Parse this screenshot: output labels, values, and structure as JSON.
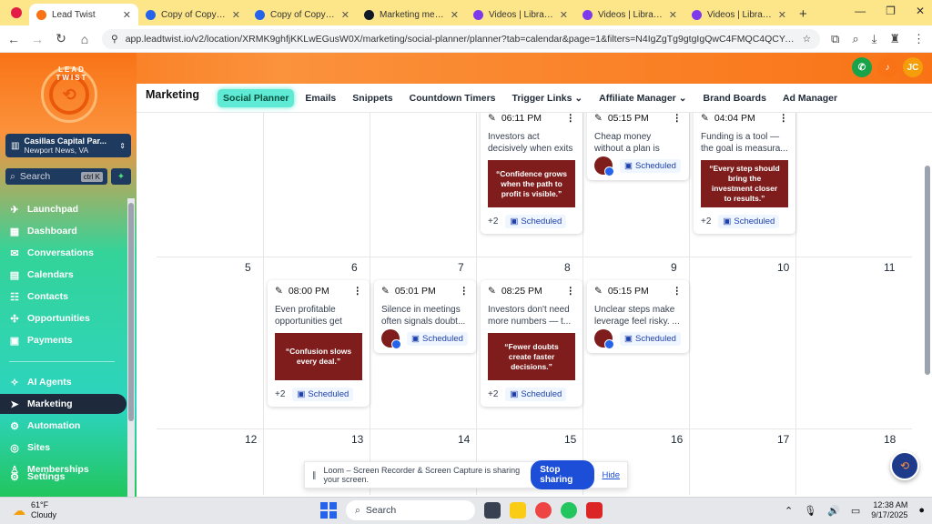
{
  "browser": {
    "tabs": [
      {
        "title": "Lead Twist",
        "active": true,
        "favicon_color": "#f97316"
      },
      {
        "title": "Copy of Copy of Co",
        "active": false,
        "favicon_color": "#2563eb"
      },
      {
        "title": "Copy of Copy of Co",
        "active": false,
        "favicon_color": "#2563eb"
      },
      {
        "title": "Marketing message",
        "active": false,
        "favicon_color": "#111827"
      },
      {
        "title": "Videos | Library |",
        "active": false,
        "favicon_color": "#7c3aed"
      },
      {
        "title": "Videos | Library | Lo",
        "active": false,
        "favicon_color": "#7c3aed"
      },
      {
        "title": "Videos | Library | Lo",
        "active": false,
        "favicon_color": "#7c3aed"
      }
    ],
    "url": "app.leadtwist.io/v2/location/XRMK9ghfjKKLwEGusW0X/marketing/social-planner/planner?tab=calendar&page=1&filters=N4IgZgTg9gtgIgQwC4FMQC4QCYAMWCsAtDgCy..."
  },
  "header": {
    "avatar_initials": "JC",
    "colors": {
      "phone": "#16a34a",
      "bell": "#f97316",
      "avatar": "#f59e0b"
    }
  },
  "sidebar": {
    "logo_text": "LEAD TWIST",
    "account": {
      "name": "Casillas Capital Par...",
      "location": "Newport News, VA"
    },
    "search": {
      "placeholder": "Search",
      "shortcut": "ctrl K"
    },
    "items": [
      {
        "label": "Launchpad",
        "icon": "rocket-icon",
        "glyph": "✈"
      },
      {
        "label": "Dashboard",
        "icon": "dashboard-icon",
        "glyph": "▦"
      },
      {
        "label": "Conversations",
        "icon": "chat-icon",
        "glyph": "✉"
      },
      {
        "label": "Calendars",
        "icon": "calendar-icon",
        "glyph": "▤"
      },
      {
        "label": "Contacts",
        "icon": "contacts-icon",
        "glyph": "☷"
      },
      {
        "label": "Opportunities",
        "icon": "opportunities-icon",
        "glyph": "✣"
      },
      {
        "label": "Payments",
        "icon": "payments-icon",
        "glyph": "▣"
      },
      {
        "label": "AI Agents",
        "icon": "ai-icon",
        "glyph": "✧"
      },
      {
        "label": "Marketing",
        "icon": "send-icon",
        "glyph": "➤"
      },
      {
        "label": "Automation",
        "icon": "automation-icon",
        "glyph": "⚙"
      },
      {
        "label": "Sites",
        "icon": "globe-icon",
        "glyph": "◎"
      },
      {
        "label": "Memberships",
        "icon": "membership-icon",
        "glyph": "♙"
      },
      {
        "label": "Settings",
        "icon": "gear-icon",
        "glyph": "⚙"
      }
    ]
  },
  "menu": {
    "title": "Marketing",
    "items": [
      {
        "label": "Social Planner",
        "active": true
      },
      {
        "label": "Emails"
      },
      {
        "label": "Snippets"
      },
      {
        "label": "Countdown Timers"
      },
      {
        "label": "Trigger Links",
        "dropdown": true
      },
      {
        "label": "Affiliate Manager",
        "dropdown": true
      },
      {
        "label": "Brand Boards"
      },
      {
        "label": "Ad Manager"
      }
    ]
  },
  "calendar": {
    "week2_days": [
      "5",
      "6",
      "7",
      "8",
      "9",
      "10",
      "11"
    ],
    "week3_days": [
      "12",
      "13",
      "14",
      "15",
      "16",
      "17",
      "18"
    ],
    "posts_week1": [
      {
        "time": "06:11 PM",
        "text": "Investors act decisively when exits and ...",
        "quote": "“Confidence grows when the path to profit is visible.”",
        "more": "+2",
        "status": "Scheduled"
      },
      {
        "time": "05:15 PM",
        "text": "Cheap money without a plan is expensi...",
        "status": "Scheduled"
      },
      {
        "time": "04:04 PM",
        "text": "Funding is a tool — the goal is measura...",
        "quote": "“Every step should bring the investment closer to results.”",
        "more": "+2",
        "status": "Scheduled"
      }
    ],
    "posts_week2": [
      {
        "time": "08:00 PM",
        "text": "Even profitable opportunities get passe...",
        "quote": "“Confusion slows every deal.”",
        "more": "+2",
        "status": "Scheduled"
      },
      {
        "time": "05:01 PM",
        "text": "Silence in meetings often signals doubt...",
        "status": "Scheduled"
      },
      {
        "time": "08:25 PM",
        "text": "Investors don't need more numbers — t...",
        "quote": "“Fewer doubts create faster decisions.”",
        "more": "+2",
        "status": "Scheduled"
      },
      {
        "time": "05:15 PM",
        "text": "Unclear steps make leverage feel risky. ...",
        "status": "Scheduled"
      }
    ]
  },
  "loom": {
    "message": "Loom – Screen Recorder & Screen Capture is sharing your screen.",
    "stop": "Stop sharing",
    "hide": "Hide"
  },
  "taskbar": {
    "temp": "61°F",
    "weather": "Cloudy",
    "search": "Search",
    "time": "12:38 AM",
    "date": "9/17/2025"
  }
}
